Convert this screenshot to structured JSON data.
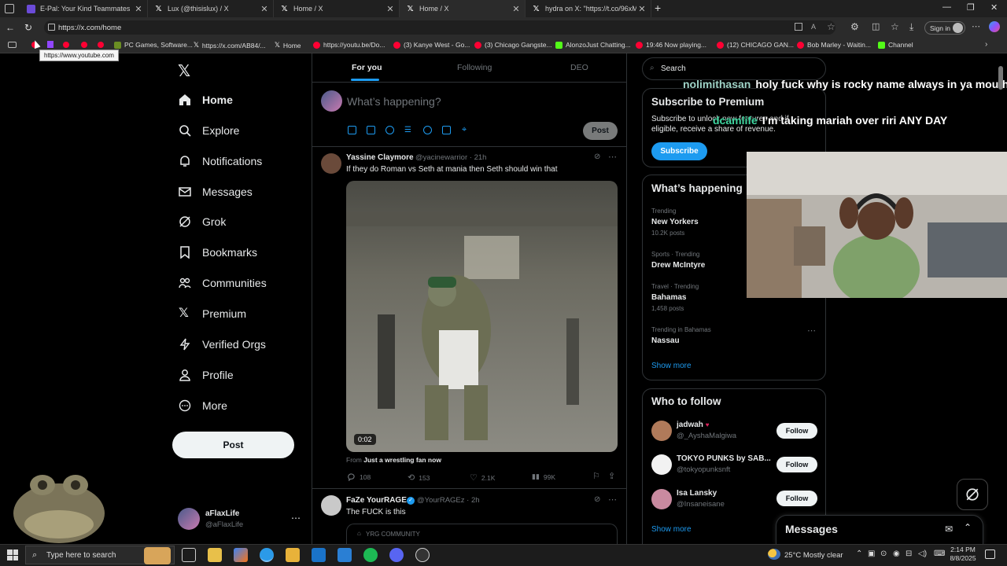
{
  "browser": {
    "tabs": [
      {
        "title": "E-Pal: Your Kind Teammates",
        "icon": "epal-icon",
        "color": "#6b4bd8"
      },
      {
        "title": "Lux (@thisislux) / X",
        "icon": "x-icon",
        "color": "#ffffff"
      },
      {
        "title": "Home / X",
        "icon": "x-icon",
        "color": "#ffffff"
      },
      {
        "title": "Home / X",
        "icon": "x-icon",
        "color": "#ffffff"
      },
      {
        "title": "hydra on X: \"https://t.co/96xMaP",
        "icon": "x-icon",
        "color": "#ffffff"
      }
    ],
    "url": "https://x.com/home",
    "sign_in": "Sign in",
    "tooltip": "https://www.youtube.com",
    "bookmarks": [
      {
        "label": "PC Games, Software...",
        "color": "#6b8e23"
      },
      {
        "label": "https://x.com/AB84/...",
        "color": "#ffffff"
      },
      {
        "label": "Home",
        "color": "#ffffff"
      },
      {
        "label": "https://youtu.be/Do...",
        "color": "#ff0033"
      },
      {
        "label": "(3) Kanye West - Go...",
        "color": "#ff0033"
      },
      {
        "label": "(3) Chicago Gangste...",
        "color": "#ff0033"
      },
      {
        "label": "AlonzoJust Chatting...",
        "color": "#53fc18"
      },
      {
        "label": "19:46 Now playing...",
        "color": "#ff0033"
      },
      {
        "label": "(12) CHICAGO GAN...",
        "color": "#ff0033"
      },
      {
        "label": "Bob Marley - Waitin...",
        "color": "#ff0033"
      },
      {
        "label": "Channel",
        "color": "#53fc18"
      }
    ]
  },
  "sidebar": {
    "items": [
      {
        "label": "Home",
        "icon": "home-icon"
      },
      {
        "label": "Explore",
        "icon": "search-icon"
      },
      {
        "label": "Notifications",
        "icon": "bell-icon"
      },
      {
        "label": "Messages",
        "icon": "mail-icon"
      },
      {
        "label": "Grok",
        "icon": "grok-icon"
      },
      {
        "label": "Bookmarks",
        "icon": "bookmark-icon"
      },
      {
        "label": "Communities",
        "icon": "people-icon"
      },
      {
        "label": "Premium",
        "icon": "x-icon"
      },
      {
        "label": "Verified Orgs",
        "icon": "lightning-icon"
      },
      {
        "label": "Profile",
        "icon": "person-icon"
      },
      {
        "label": "More",
        "icon": "more-circle-icon"
      }
    ],
    "post_label": "Post",
    "account": {
      "name": "aFlaxLife",
      "handle": "@aFlaxLife"
    }
  },
  "feed": {
    "tabs": [
      "For you",
      "Following",
      "DEO"
    ],
    "compose_placeholder": "What’s happening?",
    "compose_post": "Post",
    "tweets": [
      {
        "name": "Yassine Claymore",
        "handle": "@yacinewarrior · 21h",
        "text": "If they do Roman vs Seth at mania then Seth should win that",
        "video_time": "0:02",
        "from_prefix": "From",
        "from_source": "Just a wrestling fan now",
        "replies": "108",
        "reposts": "153",
        "likes": "2.1K",
        "views": "99K"
      },
      {
        "name": "FaZe YourRAGE",
        "handle": "@YourRAGEz · 2h",
        "text": "The FUCK is this",
        "community": "YRG COMMUNITY"
      }
    ]
  },
  "right": {
    "search_placeholder": "Search",
    "premium": {
      "title": "Subscribe to Premium",
      "text_line1": "Subscribe to unlock new features and if",
      "text_line2": "eligible, receive a share of revenue.",
      "button": "Subscribe"
    },
    "whats_happening": {
      "title": "What’s happening",
      "trends": [
        {
          "meta": "Trending",
          "name": "New Yorkers",
          "count": "10.2K posts"
        },
        {
          "meta": "Sports · Trending",
          "name": "Drew McIntyre",
          "count": ""
        },
        {
          "meta": "Travel · Trending",
          "name": "Bahamas",
          "count": "1,458 posts"
        },
        {
          "meta": "Trending in Bahamas",
          "name": "Nassau",
          "count": ""
        }
      ],
      "show_more": "Show more"
    },
    "who_to_follow": {
      "title": "Who to follow",
      "users": [
        {
          "name": "jadwah",
          "handle": "@_AyshaMalgiwa",
          "button": "Follow"
        },
        {
          "name": "TOKYO PUNKS by SAB...",
          "handle": "@tokyopunksnft",
          "button": "Follow"
        },
        {
          "name": "Isa Lansky",
          "handle": "@Insaneisane",
          "button": "Follow"
        }
      ],
      "show_more": "Show more"
    },
    "messages_label": "Messages"
  },
  "chat_overlay": [
    {
      "user": "nolimithasan",
      "text": "holy fuck why is rocky name always in ya mouth"
    },
    {
      "user": "dcamlife",
      "text": "I'm taking mariah over riri ANY DAY"
    }
  ],
  "taskbar": {
    "search_placeholder": "Type here to search",
    "weather": "25°C  Mostly clear",
    "time": "2:14 PM",
    "date": "8/8/2025"
  }
}
